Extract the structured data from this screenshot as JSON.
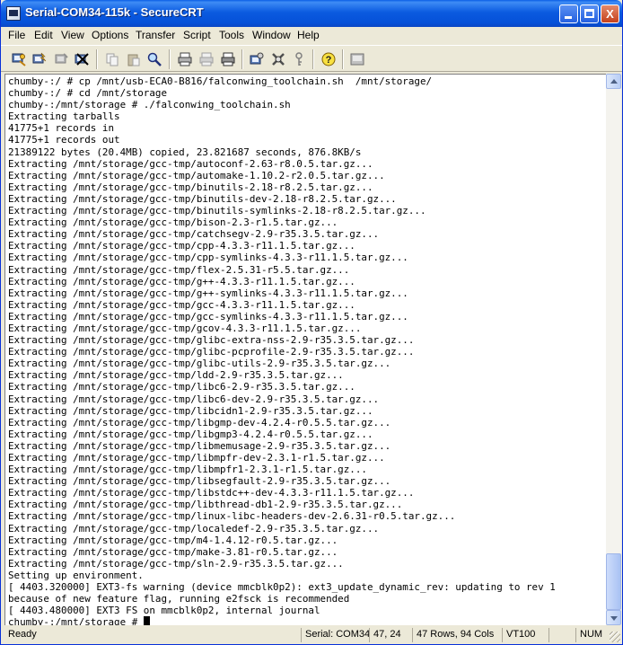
{
  "window": {
    "title": "Serial-COM34-115k - SecureCRT",
    "minimize_label": "",
    "maximize_label": "",
    "close_label": "X"
  },
  "menu": {
    "items": [
      "File",
      "Edit",
      "View",
      "Options",
      "Transfer",
      "Script",
      "Tools",
      "Window",
      "Help"
    ]
  },
  "toolbar": {
    "icons": [
      "connect-icon",
      "quick-connect-icon",
      "connect-tab-icon",
      "disconnect-icon",
      "copy-icon",
      "paste-icon",
      "find-icon",
      "print-screen-icon",
      "print-selection-icon",
      "print-icon",
      "session-options-icon",
      "global-options-icon",
      "keymap-icon",
      "help-icon",
      "sftp-icon"
    ]
  },
  "terminal": {
    "lines": [
      "chumby-:/ # cp /mnt/usb-ECA0-B816/falconwing_toolchain.sh  /mnt/storage/",
      "chumby-:/ # cd /mnt/storage",
      "chumby-:/mnt/storage # ./falconwing_toolchain.sh",
      "Extracting tarballs",
      "41775+1 records in",
      "41775+1 records out",
      "21389122 bytes (20.4MB) copied, 23.821687 seconds, 876.8KB/s",
      "Extracting /mnt/storage/gcc-tmp/autoconf-2.63-r8.0.5.tar.gz...",
      "Extracting /mnt/storage/gcc-tmp/automake-1.10.2-r2.0.5.tar.gz...",
      "Extracting /mnt/storage/gcc-tmp/binutils-2.18-r8.2.5.tar.gz...",
      "Extracting /mnt/storage/gcc-tmp/binutils-dev-2.18-r8.2.5.tar.gz...",
      "Extracting /mnt/storage/gcc-tmp/binutils-symlinks-2.18-r8.2.5.tar.gz...",
      "Extracting /mnt/storage/gcc-tmp/bison-2.3-r1.5.tar.gz...",
      "Extracting /mnt/storage/gcc-tmp/catchsegv-2.9-r35.3.5.tar.gz...",
      "Extracting /mnt/storage/gcc-tmp/cpp-4.3.3-r11.1.5.tar.gz...",
      "Extracting /mnt/storage/gcc-tmp/cpp-symlinks-4.3.3-r11.1.5.tar.gz...",
      "Extracting /mnt/storage/gcc-tmp/flex-2.5.31-r5.5.tar.gz...",
      "Extracting /mnt/storage/gcc-tmp/g++-4.3.3-r11.1.5.tar.gz...",
      "Extracting /mnt/storage/gcc-tmp/g++-symlinks-4.3.3-r11.1.5.tar.gz...",
      "Extracting /mnt/storage/gcc-tmp/gcc-4.3.3-r11.1.5.tar.gz...",
      "Extracting /mnt/storage/gcc-tmp/gcc-symlinks-4.3.3-r11.1.5.tar.gz...",
      "Extracting /mnt/storage/gcc-tmp/gcov-4.3.3-r11.1.5.tar.gz...",
      "Extracting /mnt/storage/gcc-tmp/glibc-extra-nss-2.9-r35.3.5.tar.gz...",
      "Extracting /mnt/storage/gcc-tmp/glibc-pcprofile-2.9-r35.3.5.tar.gz...",
      "Extracting /mnt/storage/gcc-tmp/glibc-utils-2.9-r35.3.5.tar.gz...",
      "Extracting /mnt/storage/gcc-tmp/ldd-2.9-r35.3.5.tar.gz...",
      "Extracting /mnt/storage/gcc-tmp/libc6-2.9-r35.3.5.tar.gz...",
      "Extracting /mnt/storage/gcc-tmp/libc6-dev-2.9-r35.3.5.tar.gz...",
      "Extracting /mnt/storage/gcc-tmp/libcidn1-2.9-r35.3.5.tar.gz...",
      "Extracting /mnt/storage/gcc-tmp/libgmp-dev-4.2.4-r0.5.5.tar.gz...",
      "Extracting /mnt/storage/gcc-tmp/libgmp3-4.2.4-r0.5.5.tar.gz...",
      "Extracting /mnt/storage/gcc-tmp/libmemusage-2.9-r35.3.5.tar.gz...",
      "Extracting /mnt/storage/gcc-tmp/libmpfr-dev-2.3.1-r1.5.tar.gz...",
      "Extracting /mnt/storage/gcc-tmp/libmpfr1-2.3.1-r1.5.tar.gz...",
      "Extracting /mnt/storage/gcc-tmp/libsegfault-2.9-r35.3.5.tar.gz...",
      "Extracting /mnt/storage/gcc-tmp/libstdc++-dev-4.3.3-r11.1.5.tar.gz...",
      "Extracting /mnt/storage/gcc-tmp/libthread-db1-2.9-r35.3.5.tar.gz...",
      "Extracting /mnt/storage/gcc-tmp/linux-libc-headers-dev-2.6.31-r0.5.tar.gz...",
      "Extracting /mnt/storage/gcc-tmp/localedef-2.9-r35.3.5.tar.gz...",
      "Extracting /mnt/storage/gcc-tmp/m4-1.4.12-r0.5.tar.gz...",
      "Extracting /mnt/storage/gcc-tmp/make-3.81-r0.5.tar.gz...",
      "Extracting /mnt/storage/gcc-tmp/sln-2.9-r35.3.5.tar.gz...",
      "Setting up environment.",
      "[ 4403.320000] EXT3-fs warning (device mmcblk0p2): ext3_update_dynamic_rev: updating to rev 1",
      "because of new feature flag, running e2fsck is recommended",
      "[ 4403.480000] EXT3 FS on mmcblk0p2, internal journal",
      "chumby-:/mnt/storage # "
    ]
  },
  "status": {
    "ready": "Ready",
    "connection": "Serial: COM34",
    "position": "47, 24",
    "size": "47 Rows, 94 Cols",
    "terminal_type": "VT100",
    "num_lock": "NUM"
  }
}
